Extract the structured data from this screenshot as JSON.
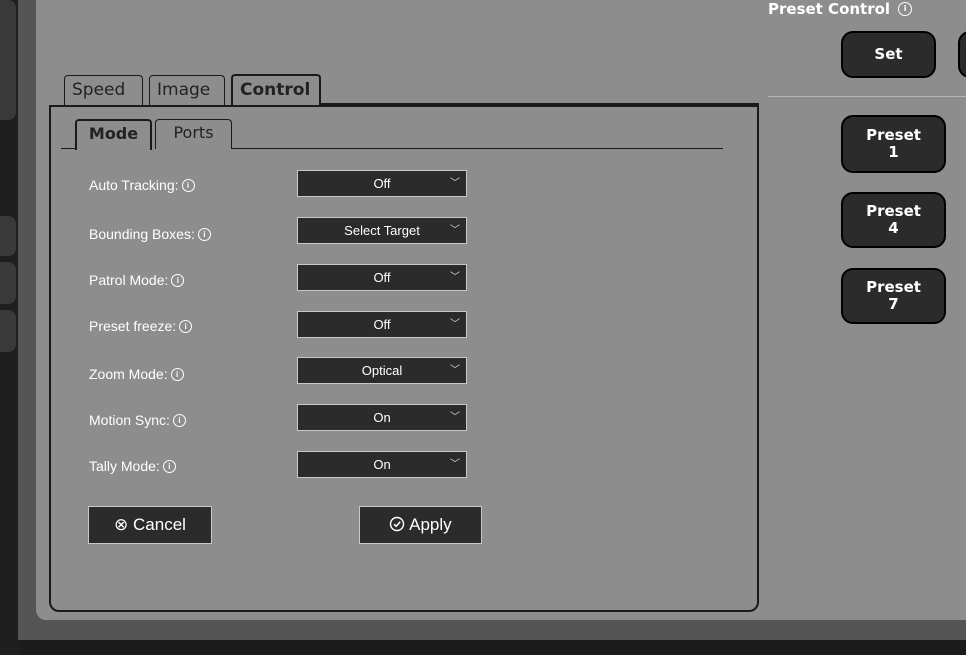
{
  "preset_control": {
    "title": "Preset Control",
    "info_icon": "info-icon",
    "set_label": "Set",
    "presets": [
      {
        "line1": "Preset",
        "line2": "1"
      },
      {
        "line1": "Preset",
        "line2": "4"
      },
      {
        "line1": "Preset",
        "line2": "7"
      }
    ]
  },
  "tabs": [
    "Speed",
    "Image",
    "Control"
  ],
  "active_tab": "Control",
  "subtabs": [
    "Mode",
    "Ports"
  ],
  "active_subtab": "Mode",
  "settings": [
    {
      "label": "Auto Tracking:",
      "value": "Off"
    },
    {
      "label": "Bounding Boxes:",
      "value": "Select Target"
    },
    {
      "label": "Patrol Mode:",
      "value": "Off"
    },
    {
      "label": "Preset freeze:",
      "value": "Off"
    },
    {
      "label": "Zoom Mode:",
      "value": "Optical"
    },
    {
      "label": "Motion Sync:",
      "value": "On"
    },
    {
      "label": "Tally Mode:",
      "value": "On"
    }
  ],
  "actions": {
    "cancel_label": "Cancel",
    "cancel_icon": "circle-x-icon",
    "apply_label": "Apply",
    "apply_icon": "circle-check-icon"
  },
  "colors": {
    "panel_bg": "#8d8d8d",
    "button_bg": "#2b2b2b",
    "text_light": "#ffffff"
  }
}
